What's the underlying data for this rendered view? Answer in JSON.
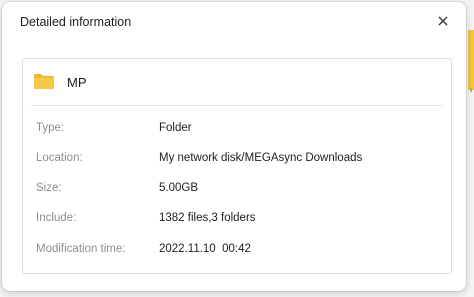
{
  "dialog": {
    "title": "Detailed information",
    "close_icon": "close-icon"
  },
  "item": {
    "name": "MP",
    "icon": "folder-icon",
    "icon_color": "#f7c948"
  },
  "properties": [
    {
      "label": "Type:",
      "value": "Folder"
    },
    {
      "label": "Location:",
      "value": "My network disk/MEGAsync Downloads"
    },
    {
      "label": "Size:",
      "value": "5.00GB"
    },
    {
      "label": "Include:",
      "value": "1382 files,3 folders"
    },
    {
      "label": "Modification time:",
      "value": "2022.11.10  00:42"
    }
  ]
}
